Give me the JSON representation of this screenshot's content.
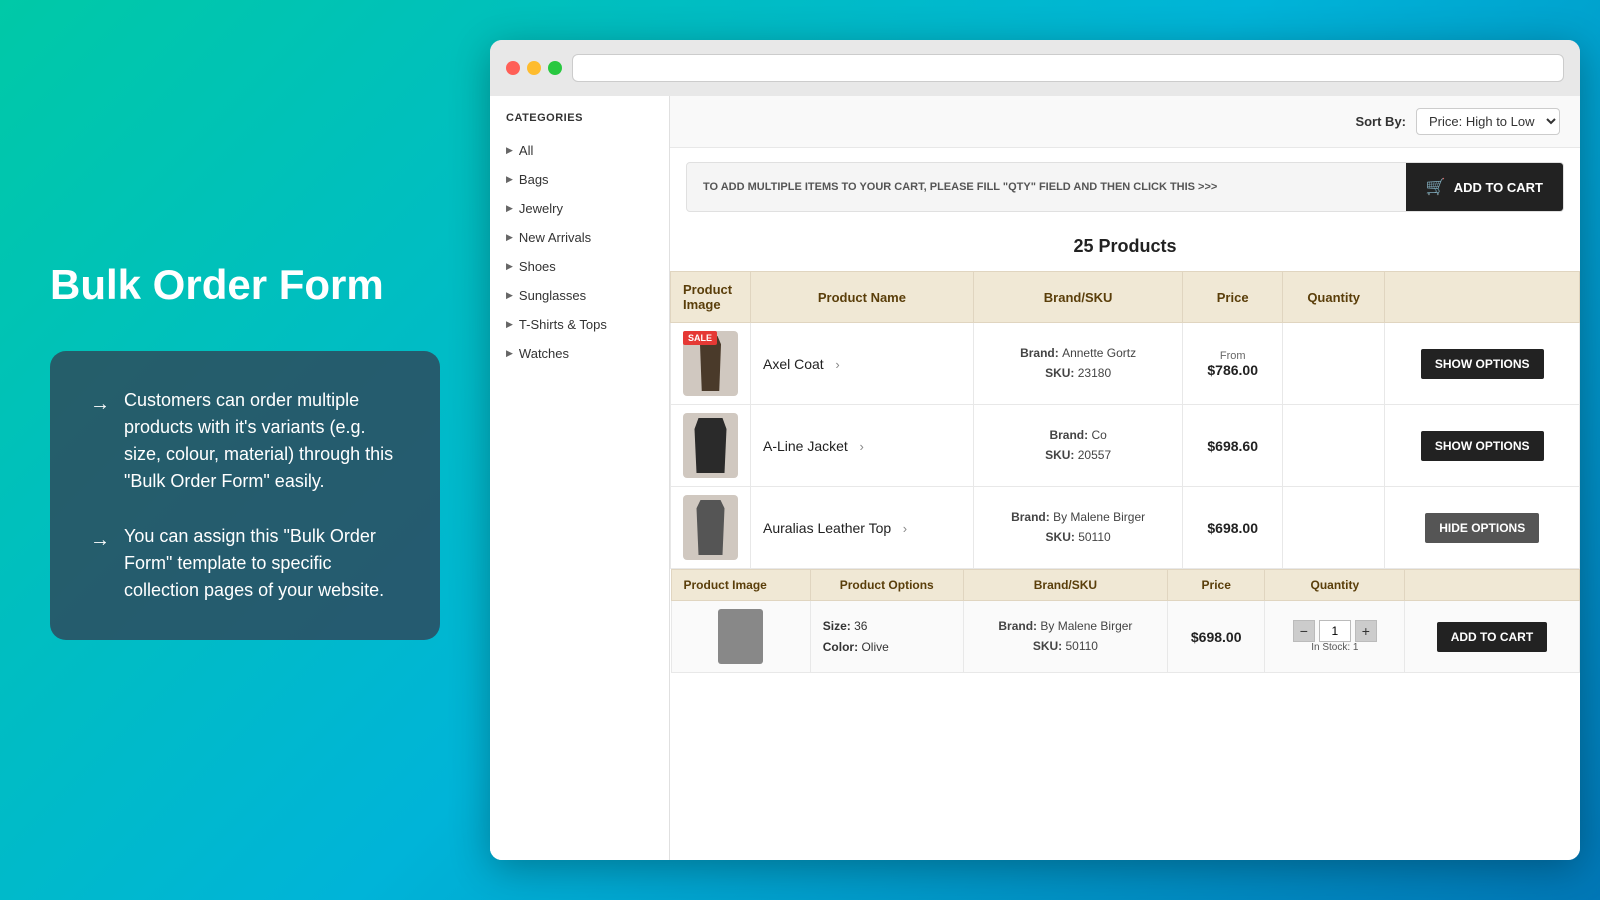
{
  "page": {
    "title": "Bulk Order Form",
    "background_gradient": "linear-gradient(135deg, #00c9a7, #00b4d8, #0077b6)"
  },
  "info_box": {
    "item1": "Customers can order multiple products with it's variants (e.g. size, colour, material) through this \"Bulk Order Form\" easily.",
    "item2": "You can assign this \"Bulk Order Form\" template to specific collection pages of your website."
  },
  "browser": {
    "url": ""
  },
  "sidebar": {
    "title": "CATEGORIES",
    "items": [
      {
        "label": "All"
      },
      {
        "label": "Bags"
      },
      {
        "label": "Jewelry"
      },
      {
        "label": "New Arrivals"
      },
      {
        "label": "Shoes"
      },
      {
        "label": "Sunglasses"
      },
      {
        "label": "T-Shirts & Tops"
      },
      {
        "label": "Watches"
      }
    ]
  },
  "sort_bar": {
    "label": "Sort By:",
    "selected": "Price: High to Low"
  },
  "add_to_cart_bar": {
    "text": "TO ADD MULTIPLE ITEMS TO YOUR CART, PLEASE FILL \"QTY\" FIELD AND THEN CLICK THIS >>>",
    "button_label": "ADD TO CART"
  },
  "products_section": {
    "heading": "25 Products",
    "columns": {
      "image": "Product Image",
      "name": "Product Name",
      "brand_sku": "Brand/SKU",
      "price": "Price",
      "quantity": "Quantity"
    },
    "products": [
      {
        "id": 1,
        "name": "Axel Coat",
        "sale": true,
        "brand": "Annette Gortz",
        "sku": "23180",
        "price_label": "From",
        "price": "$786.00",
        "show_options": true,
        "expanded": false
      },
      {
        "id": 2,
        "name": "A-Line Jacket",
        "sale": false,
        "brand": "Co",
        "sku": "20557",
        "price_label": "",
        "price": "$698.60",
        "show_options": true,
        "expanded": false
      },
      {
        "id": 3,
        "name": "Auralias Leather Top",
        "sale": false,
        "brand": "By Malene Birger",
        "sku": "50110",
        "price_label": "",
        "price": "$698.00",
        "show_options": false,
        "expanded": true
      }
    ]
  },
  "options_table": {
    "columns": {
      "image": "Product Image",
      "options": "Product Options",
      "brand_sku": "Brand/SKU",
      "price": "Price",
      "quantity": "Quantity"
    },
    "row": {
      "brand": "By Malene Birger",
      "sku": "50110",
      "size": "36",
      "color": "Olive",
      "price": "$698.00",
      "qty": "1",
      "in_stock": "In Stock: 1",
      "button_label": "ADD TO CART"
    }
  },
  "buttons": {
    "show_options": "SHOW OPTIONS",
    "hide_options": "HIDE OPTIONS",
    "add_to_cart": "ADD TO CART"
  }
}
